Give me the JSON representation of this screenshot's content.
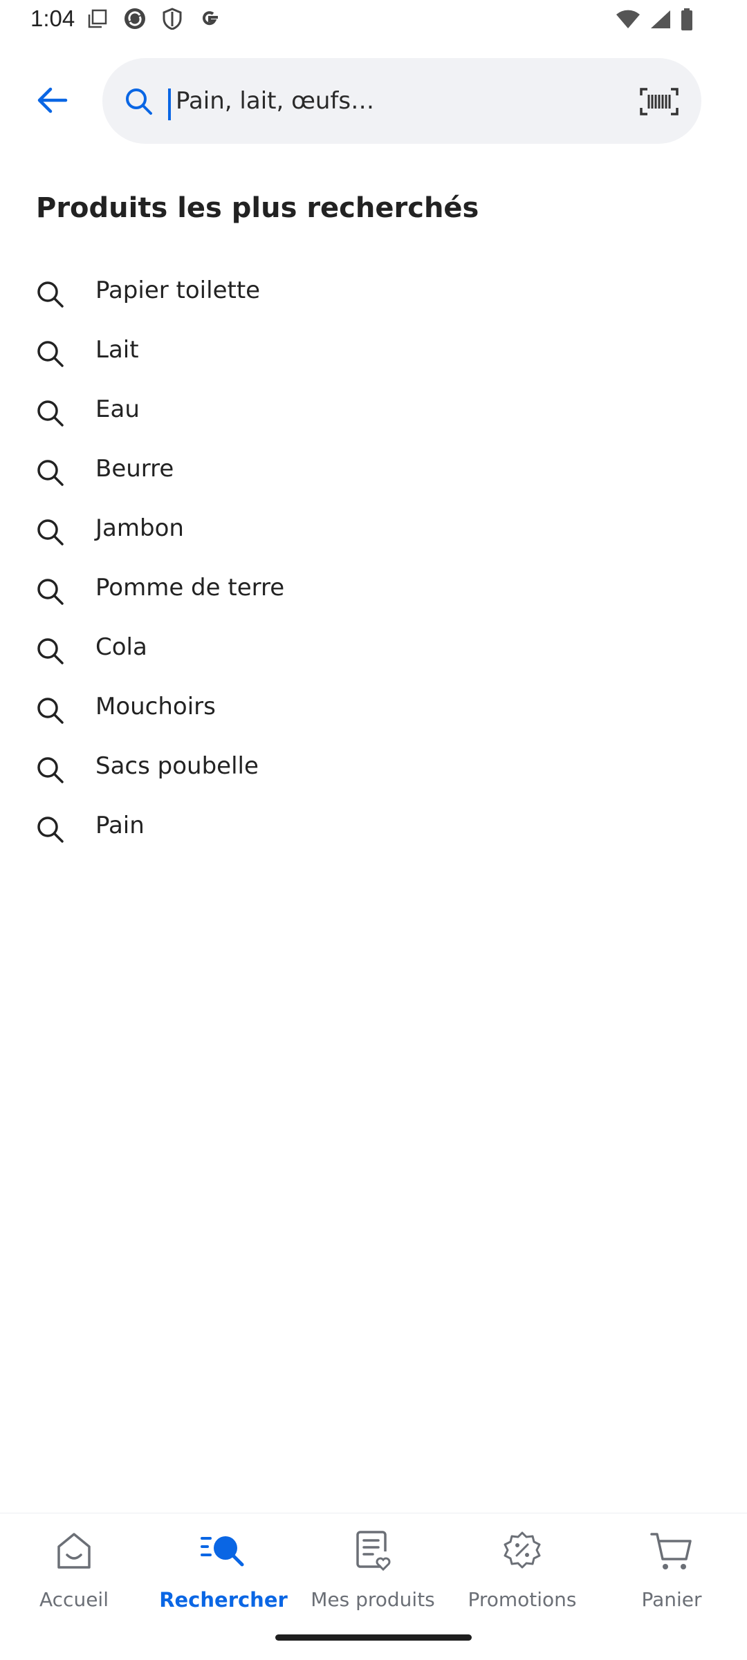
{
  "status_bar": {
    "time": "1:04",
    "left_icons": [
      "notification-copy-icon",
      "sync-app-icon",
      "shield-icon",
      "google-icon"
    ],
    "right_icons": [
      "wifi-icon",
      "cellular-icon",
      "battery-icon"
    ]
  },
  "header": {
    "back_icon": "arrow-left-icon",
    "search": {
      "placeholder": "Pain, lait, œufs…",
      "value": "",
      "search_icon": "search-icon",
      "barcode_icon": "barcode-scan-icon"
    }
  },
  "section": {
    "title": "Produits les plus recherchés",
    "items": [
      {
        "label": "Papier toilette"
      },
      {
        "label": "Lait"
      },
      {
        "label": "Eau"
      },
      {
        "label": "Beurre"
      },
      {
        "label": "Jambon"
      },
      {
        "label": "Pomme de terre"
      },
      {
        "label": "Cola"
      },
      {
        "label": "Mouchoirs"
      },
      {
        "label": "Sacs poubelle"
      },
      {
        "label": "Pain"
      }
    ]
  },
  "bottom_nav": {
    "items": [
      {
        "label": "Accueil",
        "icon": "home-icon",
        "active": false
      },
      {
        "label": "Rechercher",
        "icon": "search-icon",
        "active": true
      },
      {
        "label": "Mes produits",
        "icon": "list-heart-icon",
        "active": false
      },
      {
        "label": "Promotions",
        "icon": "promo-badge-icon",
        "active": false
      },
      {
        "label": "Panier",
        "icon": "cart-icon",
        "active": false
      }
    ]
  },
  "colors": {
    "accent": "#0a66e4",
    "text": "#222222",
    "muted": "#6b6f76",
    "search_bg": "#f1f2f5"
  }
}
